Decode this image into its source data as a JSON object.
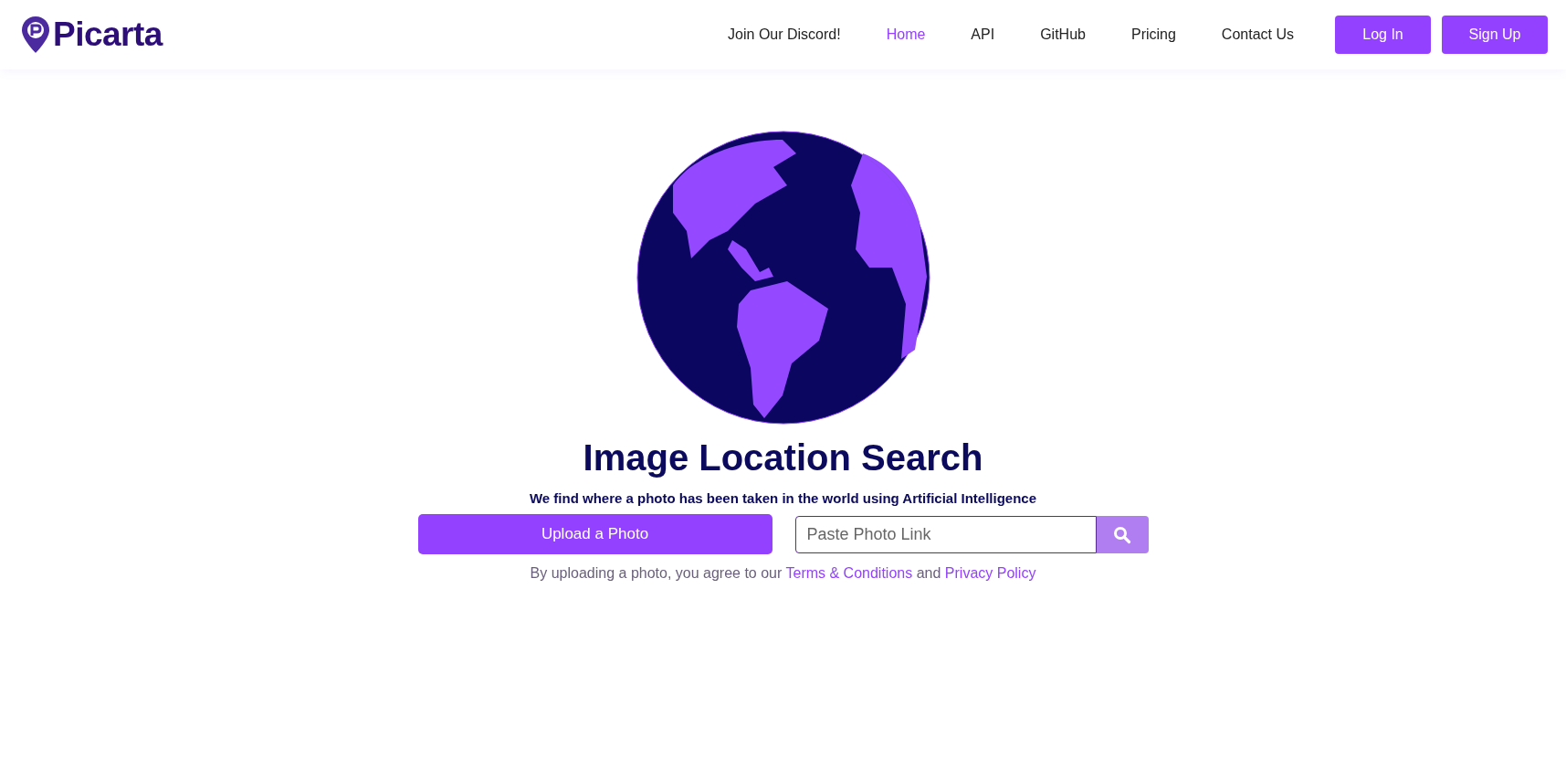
{
  "header": {
    "logo": "Picarta",
    "nav": [
      {
        "label": "Join Our Discord!",
        "selected": false
      },
      {
        "label": "Home",
        "selected": true
      },
      {
        "label": "API",
        "selected": false
      },
      {
        "label": "GitHub",
        "selected": false
      },
      {
        "label": "Pricing",
        "selected": false
      },
      {
        "label": "Contact Us",
        "selected": false
      }
    ],
    "buttons": [
      "Log In",
      "Sign Up"
    ]
  },
  "hero": {
    "title": "Image Location Search",
    "subtitle": "We find where a photo has been taken in the world using Artificial Intelligence",
    "upload_button": "Upload a Photo",
    "link_field": {
      "placeholder": "Paste Photo Link"
    },
    "disclaimer": {
      "before": "By uploading a photo, you agree to our",
      "terms_link": "Terms & Conditions",
      "middle": "and",
      "privacy_link": "Privacy Policy"
    }
  }
}
